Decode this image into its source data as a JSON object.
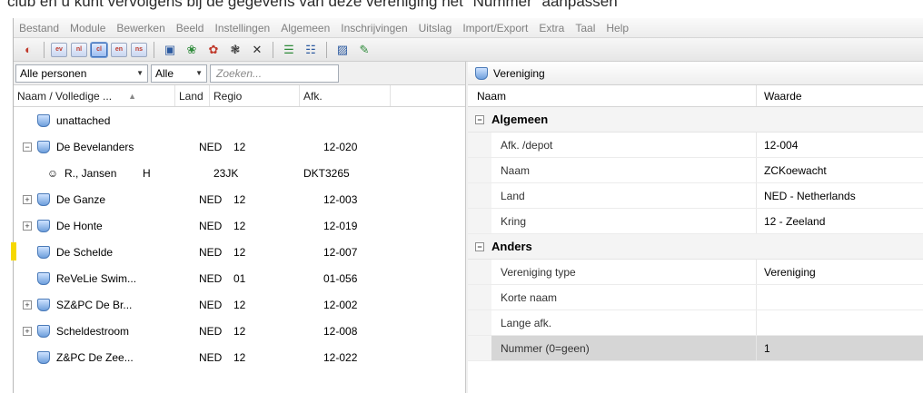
{
  "caption": "club en u kunt vervolgens bij de gegevens van deze vereniging het \"Nummer\" aanpassen",
  "menu": [
    "Bestand",
    "Module",
    "Bewerken",
    "Beeld",
    "Instellingen",
    "Algemeen",
    "Inschrijvingen",
    "Uitslag",
    "Import/Export",
    "Extra",
    "Taal",
    "Help"
  ],
  "toolbar": {
    "lang_buttons": [
      "ev",
      "nl",
      "cl",
      "en",
      "ns"
    ],
    "active_lang": "cl"
  },
  "filter": {
    "person_filter": "Alle personen",
    "scope_filter": "Alle",
    "search_placeholder": "Zoeken..."
  },
  "tree": {
    "columns": [
      "Naam / Volledige ...",
      "Land",
      "Regio",
      "Afk."
    ],
    "rows": [
      {
        "name": "unattached",
        "land": "",
        "regio": "",
        "afk": "",
        "type": "club",
        "expander": ""
      },
      {
        "name": "De Bevelanders",
        "land": "NED",
        "regio": "12",
        "afk": "12-020",
        "type": "club",
        "expander": "−"
      },
      {
        "name": "R., Jansen",
        "gender": "H",
        "land": "",
        "regio": "23JK",
        "afk": "DKT3265",
        "type": "person",
        "expander": ""
      },
      {
        "name": "De Ganze",
        "land": "NED",
        "regio": "12",
        "afk": "12-003",
        "type": "club",
        "expander": "+"
      },
      {
        "name": "De Honte",
        "land": "NED",
        "regio": "12",
        "afk": "12-019",
        "type": "club",
        "expander": "+"
      },
      {
        "name": "De Schelde",
        "land": "NED",
        "regio": "12",
        "afk": "12-007",
        "type": "club",
        "expander": ""
      },
      {
        "name": "ReVeLie Swim...",
        "land": "NED",
        "regio": "01",
        "afk": "01-056",
        "type": "club",
        "expander": ""
      },
      {
        "name": "SZ&PC De Br...",
        "land": "NED",
        "regio": "12",
        "afk": "12-002",
        "type": "club",
        "expander": "+"
      },
      {
        "name": "Scheldestroom",
        "land": "NED",
        "regio": "12",
        "afk": "12-008",
        "type": "club",
        "expander": "+"
      },
      {
        "name": "Z&PC De Zee...",
        "land": "NED",
        "regio": "12",
        "afk": "12-022",
        "type": "club",
        "expander": ""
      }
    ]
  },
  "details": {
    "title": "Vereniging",
    "columns": [
      "Naam",
      "Waarde"
    ],
    "categories": [
      {
        "name": "Algemeen",
        "props": [
          {
            "name": "Afk. /depot",
            "value": "12-004"
          },
          {
            "name": "Naam",
            "value": "ZCKoewacht"
          },
          {
            "name": "Land",
            "value": "NED - Netherlands"
          },
          {
            "name": "Kring",
            "value": "12 - Zeeland"
          }
        ]
      },
      {
        "name": "Anders",
        "props": [
          {
            "name": "Vereniging type",
            "value": "Vereniging"
          },
          {
            "name": "Korte naam",
            "value": ""
          },
          {
            "name": "Lange afk.",
            "value": ""
          },
          {
            "name": "Nummer (0=geen)",
            "value": "1"
          }
        ]
      }
    ]
  }
}
